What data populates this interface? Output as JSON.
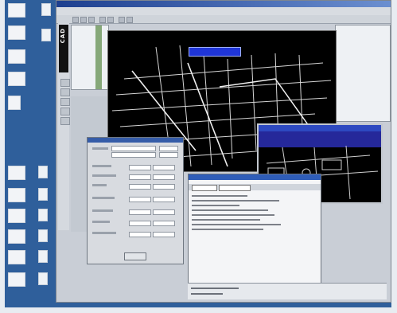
{
  "main_window": {
    "title": ""
  },
  "product_logo": {
    "text": "CAD"
  },
  "cad_view": {
    "title_box": ""
  },
  "colors": {
    "side_strip": "#2f5f9b",
    "cad_background": "#000000",
    "street_lines": "#d9d9d9",
    "title_box": "#1f35d8",
    "grid_green": "#86a879"
  },
  "icons": [
    "app-icon",
    "tool-icon",
    "close-icon"
  ]
}
